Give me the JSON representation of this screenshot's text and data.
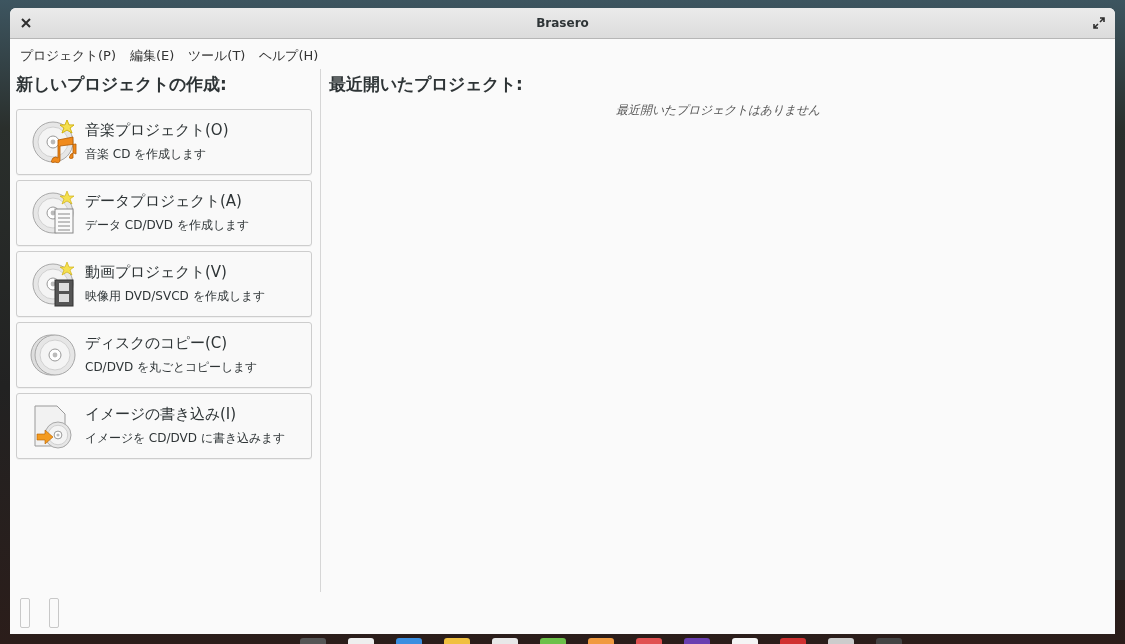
{
  "window": {
    "title": "Brasero"
  },
  "menu": [
    {
      "label": "プロジェクト(P)"
    },
    {
      "label": "編集(E)"
    },
    {
      "label": "ツール(T)"
    },
    {
      "label": "ヘルプ(H)"
    }
  ],
  "new_project": {
    "heading": "新しいプロジェクトの作成:",
    "projects": [
      {
        "kind": "audio",
        "title": "音楽プロジェクト(O)",
        "description": "音楽 CD を作成します"
      },
      {
        "kind": "data",
        "title": "データプロジェクト(A)",
        "description": "データ CD/DVD を作成します"
      },
      {
        "kind": "video",
        "title": "動画プロジェクト(V)",
        "description": "映像用 DVD/SVCD を作成します"
      },
      {
        "kind": "copy",
        "title": "ディスクのコピー(C)",
        "description": "CD/DVD を丸ごとコピーします"
      },
      {
        "kind": "image",
        "title": "イメージの書き込み(I)",
        "description": "イメージを CD/DVD に書き込みます"
      }
    ]
  },
  "recent": {
    "heading": "最近開いたプロジェクト:",
    "empty_message": "最近開いたプロジェクトはありません"
  }
}
